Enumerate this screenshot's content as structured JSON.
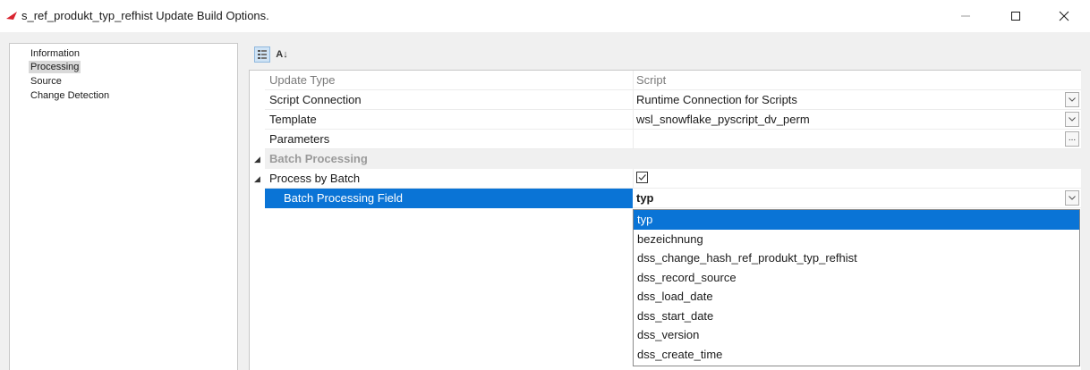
{
  "window": {
    "title": "s_ref_produkt_typ_refhist Update Build Options.",
    "minimize_glyph": "—",
    "maximize_glyph": "☐",
    "close_glyph": "✕"
  },
  "nav": {
    "items": [
      {
        "label": "Information",
        "selected": false
      },
      {
        "label": "Processing",
        "selected": true
      },
      {
        "label": "Source",
        "selected": false
      },
      {
        "label": "Change Detection",
        "selected": false
      }
    ]
  },
  "toolbar": {
    "categorized_icon": "categorized-view-icon",
    "alphabetical_label": "A↓"
  },
  "grid": {
    "update_type": {
      "name": "Update Type",
      "value": "Script"
    },
    "script_connection": {
      "name": "Script Connection",
      "value": "Runtime Connection for Scripts"
    },
    "template": {
      "name": "Template",
      "value": "wsl_snowflake_pyscript_dv_perm"
    },
    "parameters": {
      "name": "Parameters",
      "value": "",
      "button": "..."
    },
    "batch_category": {
      "name": "Batch Processing"
    },
    "process_by_batch": {
      "name": "Process by Batch",
      "checked": true
    },
    "batch_field": {
      "name": "Batch Processing Field",
      "value": "typ"
    }
  },
  "dropdown": {
    "options": [
      {
        "label": "typ",
        "selected": true
      },
      {
        "label": "bezeichnung",
        "selected": false
      },
      {
        "label": "dss_change_hash_ref_produkt_typ_refhist",
        "selected": false
      },
      {
        "label": "dss_record_source",
        "selected": false
      },
      {
        "label": "dss_load_date",
        "selected": false
      },
      {
        "label": "dss_start_date",
        "selected": false
      },
      {
        "label": "dss_version",
        "selected": false
      },
      {
        "label": "dss_create_time",
        "selected": false
      }
    ]
  },
  "colors": {
    "selection": "#0a74d6",
    "app_icon": "#d9232e"
  }
}
